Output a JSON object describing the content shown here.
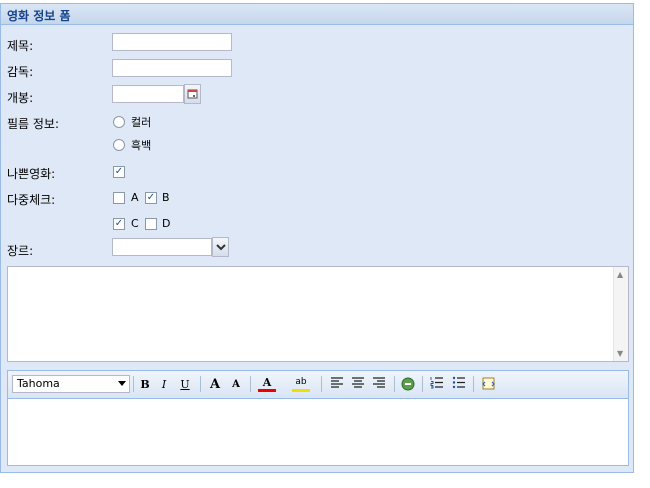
{
  "panel": {
    "title": "영화 정보 폼"
  },
  "form": {
    "title_label": "제목:",
    "director_label": "감독:",
    "release_label": "개봉:",
    "film_label": "필름 정보:",
    "film_options": [
      "컬러",
      "흑백"
    ],
    "bad_movie_label": "나쁜영화:",
    "multi_check_label": "다중체크:",
    "multi_options": [
      "A",
      "B",
      "C",
      "D"
    ],
    "multi_checked": [
      false,
      true,
      true,
      false
    ],
    "bad_movie_checked": true,
    "genre_label": "장르:"
  },
  "editor": {
    "font": "Tahoma",
    "bold": "B",
    "italic": "I",
    "underline": "U",
    "grow": "A",
    "shrink": "A",
    "font_color": "A",
    "highlight": "ab"
  }
}
